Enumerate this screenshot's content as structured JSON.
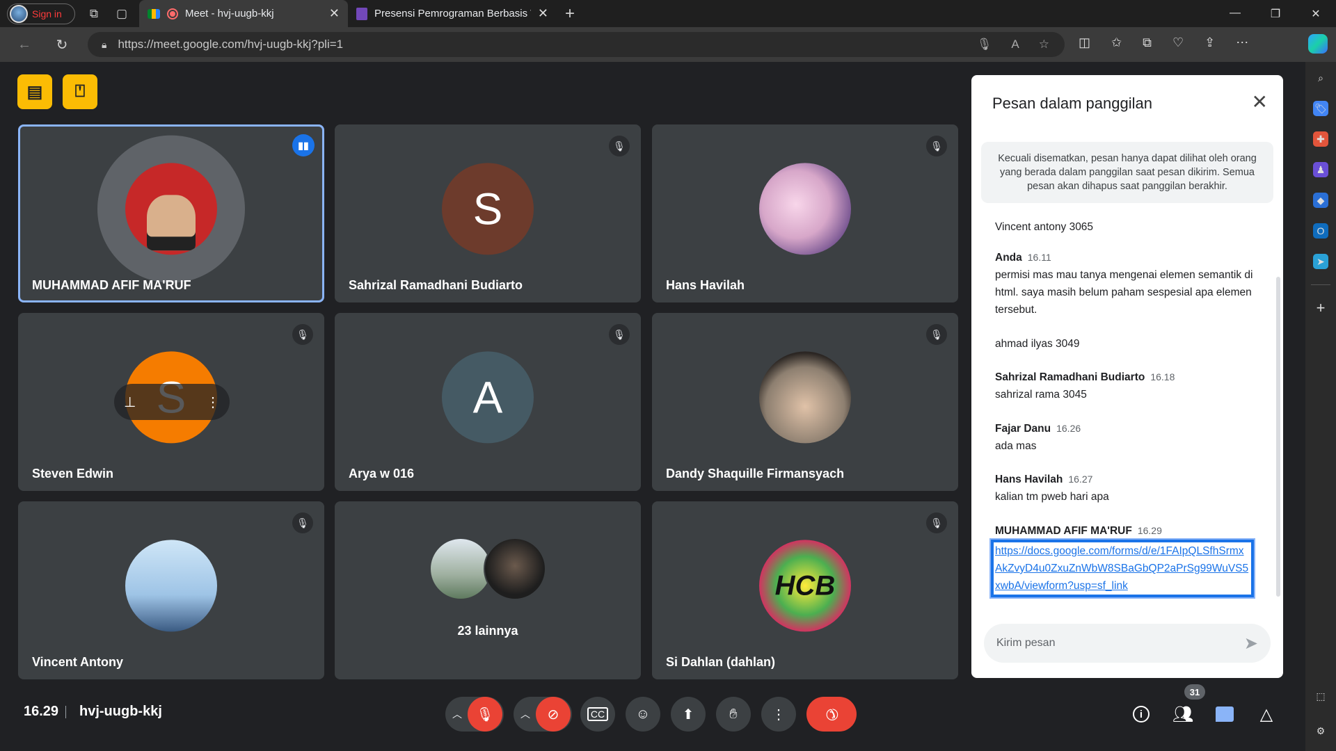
{
  "browser": {
    "profile_label": "Sign in",
    "tabs": [
      {
        "title": "Meet - hvj-uugb-kkj",
        "active": true,
        "icon": "meet-icon"
      },
      {
        "title": "Presensi Pemrograman Berbasis W",
        "active": false,
        "icon": "forms-icon"
      }
    ],
    "new_tab": "+",
    "url": "https://meet.google.com/hvj-uugb-kkj?pli=1"
  },
  "meet": {
    "tiles": [
      {
        "name": "MUHAMMAD AFIF MA'RUF",
        "avatar_color": "#c62828",
        "initial": "",
        "speaking": true
      },
      {
        "name": "Sahrizal Ramadhani Budiarto",
        "avatar_color": "#6d3b2c",
        "initial": "S"
      },
      {
        "name": "Hans Havilah",
        "avatar_color": "#d7a7c9",
        "initial": ""
      },
      {
        "name": "Steven Edwin",
        "avatar_color": "#f57c00",
        "initial": "S"
      },
      {
        "name": "Arya w 016",
        "avatar_color": "#455a64",
        "initial": "A"
      },
      {
        "name": "Dandy Shaquille Firmansyach",
        "avatar_color": "#8d7f70",
        "initial": ""
      },
      {
        "name": "Vincent Antony",
        "avatar_color": "#9ec4e6",
        "initial": ""
      },
      {
        "name": "23 lainnya",
        "avatar_color": "#3c4043",
        "initial": ""
      },
      {
        "name": "Si Dahlan (dahlan)",
        "avatar_color": "#2e7d32",
        "initial": ""
      }
    ],
    "clock": "16.29",
    "meeting_code": "hvj-uugb-kkj",
    "participant_count": "31",
    "colors": {
      "accent": "#1a73e8",
      "danger": "#ea4335",
      "host": "#fbbc04"
    }
  },
  "chat": {
    "title": "Pesan dalam panggilan",
    "note": "Kecuali disematkan, pesan hanya dapat dilihat oleh orang yang berada dalam panggilan saat pesan dikirim. Semua pesan akan dihapus saat panggilan berakhir.",
    "messages": [
      {
        "sender": "",
        "time": "",
        "text": "Vincent antony 3065"
      },
      {
        "sender": "Anda",
        "time": "16.11",
        "text": "permisi mas mau tanya mengenai elemen semantik di html. saya masih belum paham sespesial apa elemen tersebut."
      },
      {
        "sender": "",
        "time": "",
        "text": "ahmad ilyas 3049"
      },
      {
        "sender": "Sahrizal Ramadhani Budiarto",
        "time": "16.18",
        "text": "sahrizal rama 3045"
      },
      {
        "sender": "Fajar Danu",
        "time": "16.26",
        "text": "ada mas"
      },
      {
        "sender": "Hans Havilah",
        "time": "16.27",
        "text": "kalian tm pweb hari apa"
      },
      {
        "sender": "MUHAMMAD AFIF MA'RUF",
        "time": "16.29",
        "text": "https://docs.google.com/forms/d/e/1FAIpQLSfhSrmxAkZvyD4u0ZxuZnWbW8SBaGbQP2aPrSg99WuVS5xwbA/viewform?usp=sf_link"
      }
    ],
    "input_placeholder": "Kirim pesan"
  }
}
